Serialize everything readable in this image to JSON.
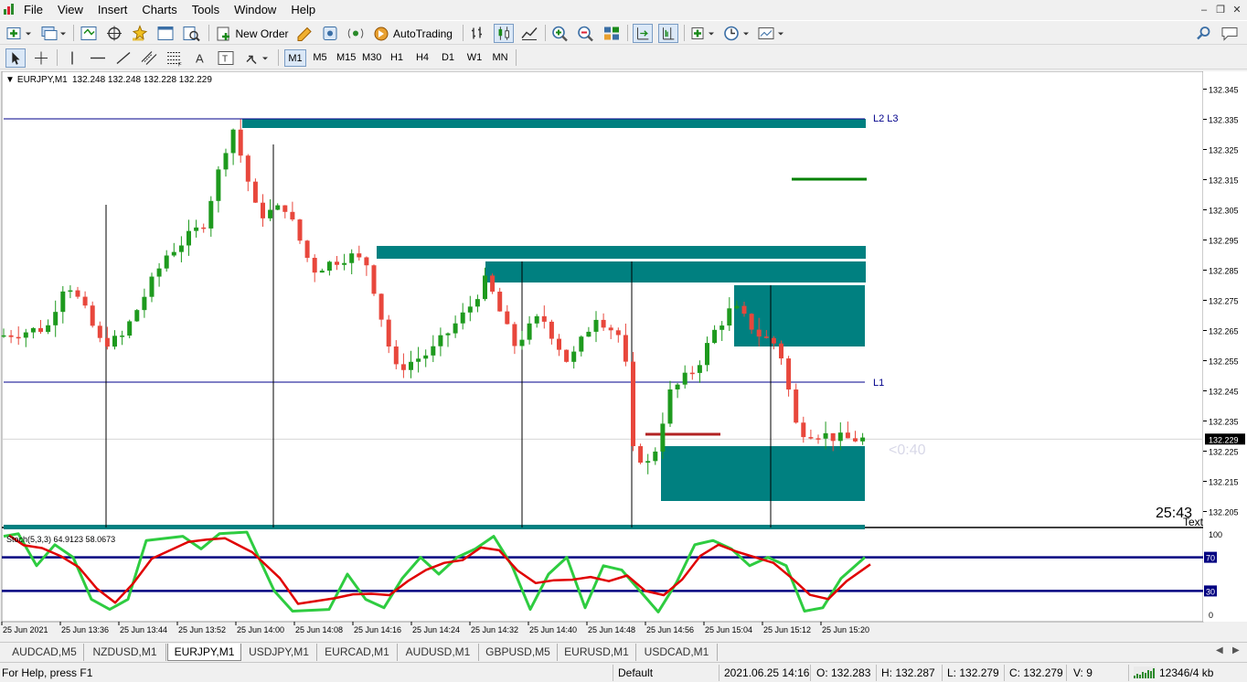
{
  "menu": {
    "items": [
      "File",
      "View",
      "Insert",
      "Charts",
      "Tools",
      "Window",
      "Help"
    ]
  },
  "toolbar": {
    "new_order": "New Order",
    "auto_trading": "AutoTrading"
  },
  "timeframes": {
    "items": [
      "M1",
      "M5",
      "M15",
      "M30",
      "H1",
      "H4",
      "D1",
      "W1",
      "MN"
    ],
    "active": "M1"
  },
  "chart": {
    "header": "EURJPY,M1  132.248 132.248 132.228 132.229",
    "symbol": "EURJPY,M1",
    "ohlc": "132.248 132.248 132.228 132.229",
    "current_price": "132.229",
    "line_labels": {
      "upper": "L2 L3",
      "lower": "L1"
    },
    "bar_countdown": "<0:40",
    "clock": "25:43",
    "text_label": "Text",
    "price_ticks": [
      "132.345",
      "132.335",
      "132.325",
      "132.315",
      "132.305",
      "132.295",
      "132.285",
      "132.275",
      "132.265",
      "132.255",
      "132.245",
      "132.235",
      "132.225",
      "132.215",
      "132.205"
    ],
    "time_ticks": [
      "25 Jun 2021",
      "25 Jun 13:36",
      "25 Jun 13:44",
      "25 Jun 13:52",
      "25 Jun 14:00",
      "25 Jun 14:08",
      "25 Jun 14:16",
      "25 Jun 14:24",
      "25 Jun 14:32",
      "25 Jun 14:40",
      "25 Jun 14:48",
      "25 Jun 14:56",
      "25 Jun 15:04",
      "25 Jun 15:12",
      "25 Jun 15:20"
    ],
    "colors": {
      "bull": "#1e9a1e",
      "bear": "#e8473c",
      "zone": "#008080",
      "hline": "#00008b",
      "green_line": "#008000",
      "red_line": "#b22222"
    }
  },
  "stoch": {
    "label": "Stoch(5,3,3) 64.9123 58.0673",
    "levels": [
      "70",
      "30"
    ],
    "scale": [
      "100",
      "0"
    ],
    "colors": {
      "main": "#2ecc40",
      "signal": "#e00000",
      "level": "#000080"
    }
  },
  "tabs": {
    "items": [
      "AUDCAD,M5",
      "NZDUSD,M1",
      "EURJPY,M1",
      "USDJPY,M1",
      "EURCAD,M1",
      "AUDUSD,M1",
      "GBPUSD,M5",
      "EURUSD,M1",
      "USDCAD,M1"
    ],
    "active": "EURJPY,M1"
  },
  "status": {
    "help": "For Help, press F1",
    "profile": "Default",
    "datetime": "2021.06.25 14:16",
    "open": "O: 132.283",
    "high": "H: 132.287",
    "low": "L: 132.279",
    "close": "C: 132.279",
    "volume": "V: 9",
    "traffic": "12346/4 kb"
  }
}
